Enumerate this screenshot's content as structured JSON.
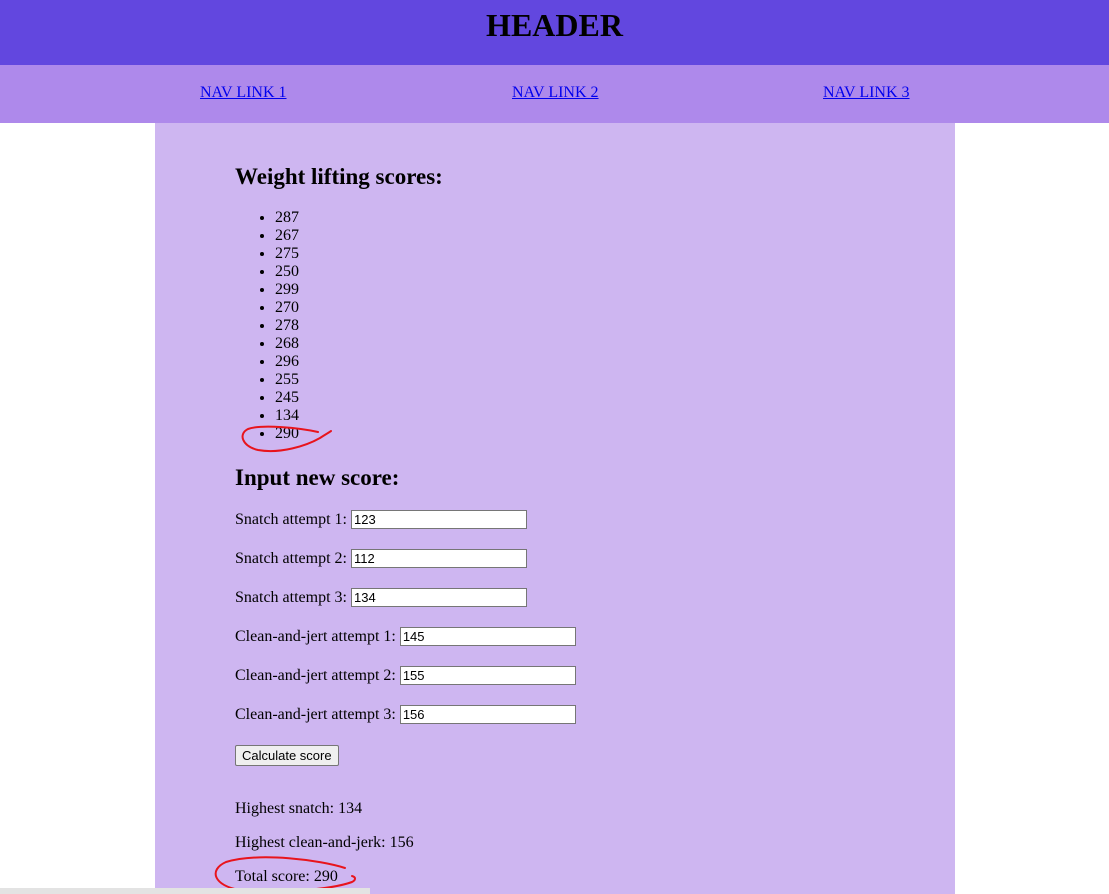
{
  "header": {
    "title": "HEADER"
  },
  "nav": {
    "links": [
      "NAV LINK 1",
      "NAV LINK 2",
      "NAV LINK 3"
    ]
  },
  "scores": {
    "heading": "Weight lifting scores:",
    "items": [
      "287",
      "267",
      "275",
      "250",
      "299",
      "270",
      "278",
      "268",
      "296",
      "255",
      "245",
      "134",
      "290"
    ]
  },
  "form": {
    "heading": "Input new score:",
    "fields": [
      {
        "label": "Snatch attempt 1:",
        "value": "123"
      },
      {
        "label": "Snatch attempt 2:",
        "value": "112"
      },
      {
        "label": "Snatch attempt 3:",
        "value": "134"
      },
      {
        "label": "Clean-and-jert attempt 1:",
        "value": "145"
      },
      {
        "label": "Clean-and-jert attempt 2:",
        "value": "155"
      },
      {
        "label": "Clean-and-jert attempt 3:",
        "value": "156"
      }
    ],
    "button_label": "Calculate score"
  },
  "results": {
    "highest_snatch": "Highest snatch: 134",
    "highest_clean_and_jerk": "Highest clean-and-jerk: 156",
    "total_score": "Total score: 290"
  },
  "colors": {
    "header_bg": "#6247df",
    "nav_bg": "#ae89eb",
    "main_bg": "#ceb6f1",
    "annotation": "#e8141c",
    "link": "#0000ee"
  }
}
